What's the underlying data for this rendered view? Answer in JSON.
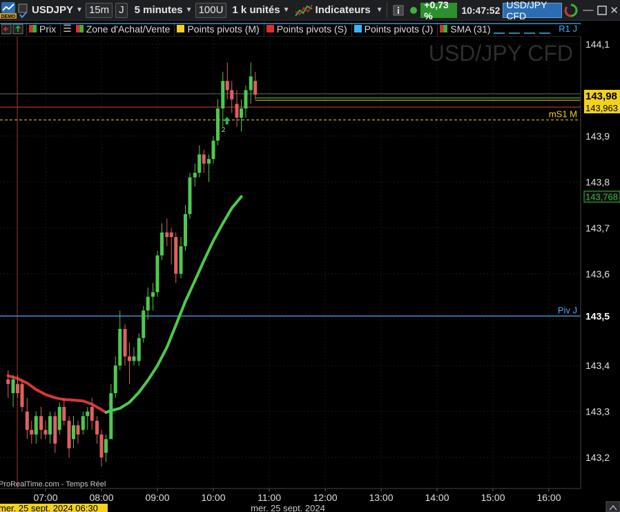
{
  "toolbar": {
    "demo_badge": "DEMO",
    "symbol": "USDJPY",
    "period": "15m",
    "period2": "J",
    "timeframe": "5 minutes",
    "units_count": "100U",
    "units_mode": "1 k unités",
    "indicators_label": "Indicateurs",
    "change_pct": "+0,73 %",
    "clock": "10:47:52",
    "instrument": "USD/JPY CFD"
  },
  "legend": [
    {
      "label": "Prix",
      "color": "#cc3333"
    },
    {
      "label": "Zone d'Achat/Vente",
      "color": "#3bb33b"
    },
    {
      "label": "Points pivots (M)",
      "color": "#f3d21b"
    },
    {
      "label": "Points pivots (S)",
      "color": "#d9312c"
    },
    {
      "label": "Points pivots (J)",
      "color": "#3fb1f5"
    },
    {
      "label": "SMA (31)",
      "color": "#3bb33b"
    }
  ],
  "watermark": "USD/JPY CFD",
  "copyright": "ProRealTime.com - Temps Réel",
  "cursor_date": "mer. 25 sept. 2024 06:30",
  "date_label": "mer. 25 sept. 2024",
  "chart_data": {
    "type": "candlestick",
    "title": "USD/JPY CFD",
    "ylim": [
      143.14,
      144.12
    ],
    "y_ticks": [
      "144,1",
      "143,9",
      "143,8",
      "143,7",
      "143,6",
      "143,5",
      "143,4",
      "143,3",
      "143,2"
    ],
    "y_tick_values": [
      144.1,
      143.9,
      143.8,
      143.7,
      143.6,
      143.5,
      143.4,
      143.3,
      143.2
    ],
    "x_ticks": [
      "07:00",
      "08:00",
      "09:00",
      "10:00",
      "11:00",
      "12:00",
      "13:00",
      "14:00",
      "15:00",
      "16:00"
    ],
    "x_tick_hours": [
      7,
      8,
      9,
      10,
      11,
      12,
      13,
      14,
      15,
      16
    ],
    "xlim_hours": [
      6.33,
      16.58
    ],
    "price_labels": [
      {
        "text": "143,98",
        "value": 143.98,
        "bg": "#f3d21b",
        "fg": "#000"
      },
      {
        "text": "143,963",
        "value": 143.963,
        "bg": "#f3d21b",
        "fg": "#000"
      },
      {
        "text": "143,768",
        "value": 143.768,
        "bg": "#111",
        "fg": "#3bb33b"
      },
      {
        "text": "143,5",
        "value": 143.508,
        "bg": "#000",
        "fg": "#fff"
      }
    ],
    "levels": [
      {
        "name": "R1 J",
        "value": 144.145,
        "color": "#3fb1f5",
        "style": "solid"
      },
      {
        "name": "",
        "value": 143.992,
        "color": "#555",
        "style": "solid"
      },
      {
        "name": "",
        "value": 143.963,
        "color": "#a33",
        "style": "solid"
      },
      {
        "name": "mS1 M",
        "value": 143.935,
        "color": "#f3d21b",
        "style": "dashed"
      },
      {
        "name": "Piv J",
        "value": 143.508,
        "color": "#3fb1f5",
        "style": "solid"
      }
    ],
    "current_price_lines": [
      143.983,
      143.978
    ],
    "candles": [
      {
        "t": 6.33,
        "o": 143.37,
        "h": 143.39,
        "l": 143.33,
        "c": 143.36
      },
      {
        "t": 6.42,
        "o": 143.34,
        "h": 143.38,
        "l": 143.31,
        "c": 143.37
      },
      {
        "t": 6.5,
        "o": 143.36,
        "h": 143.38,
        "l": 143.33,
        "c": 143.34
      },
      {
        "t": 6.58,
        "o": 143.36,
        "h": 143.37,
        "l": 143.3,
        "c": 143.31
      },
      {
        "t": 6.67,
        "o": 143.3,
        "h": 143.33,
        "l": 143.24,
        "c": 143.26
      },
      {
        "t": 6.75,
        "o": 143.26,
        "h": 143.28,
        "l": 143.23,
        "c": 143.25
      },
      {
        "t": 6.83,
        "o": 143.25,
        "h": 143.3,
        "l": 143.23,
        "c": 143.29
      },
      {
        "t": 6.92,
        "o": 143.29,
        "h": 143.31,
        "l": 143.24,
        "c": 143.26
      },
      {
        "t": 7.0,
        "o": 143.26,
        "h": 143.28,
        "l": 143.24,
        "c": 143.25
      },
      {
        "t": 7.08,
        "o": 143.25,
        "h": 143.3,
        "l": 143.23,
        "c": 143.29
      },
      {
        "t": 7.17,
        "o": 143.29,
        "h": 143.3,
        "l": 143.21,
        "c": 143.23
      },
      {
        "t": 7.25,
        "o": 143.26,
        "h": 143.32,
        "l": 143.25,
        "c": 143.31
      },
      {
        "t": 7.33,
        "o": 143.31,
        "h": 143.33,
        "l": 143.27,
        "c": 143.28
      },
      {
        "t": 7.42,
        "o": 143.28,
        "h": 143.29,
        "l": 143.2,
        "c": 143.22
      },
      {
        "t": 7.5,
        "o": 143.24,
        "h": 143.29,
        "l": 143.22,
        "c": 143.27
      },
      {
        "t": 7.58,
        "o": 143.27,
        "h": 143.28,
        "l": 143.23,
        "c": 143.25
      },
      {
        "t": 7.67,
        "o": 143.26,
        "h": 143.3,
        "l": 143.25,
        "c": 143.29
      },
      {
        "t": 7.75,
        "o": 143.29,
        "h": 143.31,
        "l": 143.26,
        "c": 143.3
      },
      {
        "t": 7.83,
        "o": 143.31,
        "h": 143.33,
        "l": 143.26,
        "c": 143.28
      },
      {
        "t": 7.92,
        "o": 143.28,
        "h": 143.29,
        "l": 143.23,
        "c": 143.25
      },
      {
        "t": 8.0,
        "o": 143.25,
        "h": 143.26,
        "l": 143.18,
        "c": 143.2
      },
      {
        "t": 8.08,
        "o": 143.21,
        "h": 143.25,
        "l": 143.19,
        "c": 143.24
      },
      {
        "t": 8.17,
        "o": 143.24,
        "h": 143.36,
        "l": 143.24,
        "c": 143.34
      },
      {
        "t": 8.25,
        "o": 143.34,
        "h": 143.42,
        "l": 143.33,
        "c": 143.4
      },
      {
        "t": 8.33,
        "o": 143.4,
        "h": 143.52,
        "l": 143.39,
        "c": 143.48
      },
      {
        "t": 8.42,
        "o": 143.48,
        "h": 143.49,
        "l": 143.4,
        "c": 143.42
      },
      {
        "t": 8.5,
        "o": 143.42,
        "h": 143.45,
        "l": 143.36,
        "c": 143.41
      },
      {
        "t": 8.58,
        "o": 143.41,
        "h": 143.44,
        "l": 143.4,
        "c": 143.42
      },
      {
        "t": 8.67,
        "o": 143.41,
        "h": 143.47,
        "l": 143.4,
        "c": 143.46
      },
      {
        "t": 8.75,
        "o": 143.46,
        "h": 143.53,
        "l": 143.45,
        "c": 143.52
      },
      {
        "t": 8.83,
        "o": 143.52,
        "h": 143.57,
        "l": 143.5,
        "c": 143.55
      },
      {
        "t": 8.92,
        "o": 143.55,
        "h": 143.58,
        "l": 143.52,
        "c": 143.56
      },
      {
        "t": 9.0,
        "o": 143.56,
        "h": 143.65,
        "l": 143.55,
        "c": 143.64
      },
      {
        "t": 9.08,
        "o": 143.64,
        "h": 143.71,
        "l": 143.63,
        "c": 143.69
      },
      {
        "t": 9.17,
        "o": 143.69,
        "h": 143.72,
        "l": 143.66,
        "c": 143.68
      },
      {
        "t": 9.25,
        "o": 143.69,
        "h": 143.7,
        "l": 143.62,
        "c": 143.68
      },
      {
        "t": 9.33,
        "o": 143.68,
        "h": 143.69,
        "l": 143.58,
        "c": 143.6
      },
      {
        "t": 9.42,
        "o": 143.6,
        "h": 143.68,
        "l": 143.59,
        "c": 143.66
      },
      {
        "t": 9.5,
        "o": 143.66,
        "h": 143.75,
        "l": 143.65,
        "c": 143.73
      },
      {
        "t": 9.58,
        "o": 143.73,
        "h": 143.82,
        "l": 143.72,
        "c": 143.81
      },
      {
        "t": 9.67,
        "o": 143.81,
        "h": 143.84,
        "l": 143.79,
        "c": 143.82
      },
      {
        "t": 9.75,
        "o": 143.82,
        "h": 143.88,
        "l": 143.81,
        "c": 143.86
      },
      {
        "t": 9.83,
        "o": 143.86,
        "h": 143.87,
        "l": 143.82,
        "c": 143.84
      },
      {
        "t": 9.92,
        "o": 143.84,
        "h": 143.86,
        "l": 143.8,
        "c": 143.85
      },
      {
        "t": 10.0,
        "o": 143.85,
        "h": 143.9,
        "l": 143.84,
        "c": 143.89
      },
      {
        "t": 10.08,
        "o": 143.89,
        "h": 143.98,
        "l": 143.88,
        "c": 143.96
      },
      {
        "t": 10.17,
        "o": 143.96,
        "h": 144.04,
        "l": 143.92,
        "c": 144.02
      },
      {
        "t": 10.25,
        "o": 144.02,
        "h": 144.06,
        "l": 143.98,
        "c": 144.0
      },
      {
        "t": 10.33,
        "o": 144.0,
        "h": 144.02,
        "l": 143.95,
        "c": 143.98
      },
      {
        "t": 10.42,
        "o": 143.97,
        "h": 144.0,
        "l": 143.92,
        "c": 143.94
      },
      {
        "t": 10.5,
        "o": 143.94,
        "h": 143.98,
        "l": 143.91,
        "c": 143.96
      },
      {
        "t": 10.58,
        "o": 143.96,
        "h": 144.01,
        "l": 143.94,
        "c": 144.0
      },
      {
        "t": 10.67,
        "o": 144.0,
        "h": 144.06,
        "l": 143.97,
        "c": 144.03
      },
      {
        "t": 10.75,
        "o": 144.02,
        "h": 144.04,
        "l": 143.98,
        "c": 143.99
      }
    ],
    "sma": [
      {
        "t": 6.33,
        "v": 143.378
      },
      {
        "t": 6.5,
        "v": 143.372
      },
      {
        "t": 6.67,
        "v": 143.362
      },
      {
        "t": 6.83,
        "v": 143.348
      },
      {
        "t": 7.0,
        "v": 143.337
      },
      {
        "t": 7.17,
        "v": 143.33
      },
      {
        "t": 7.33,
        "v": 143.326
      },
      {
        "t": 7.5,
        "v": 143.325
      },
      {
        "t": 7.67,
        "v": 143.323
      },
      {
        "t": 7.83,
        "v": 143.316
      },
      {
        "t": 8.0,
        "v": 143.304
      },
      {
        "t": 8.08,
        "v": 143.298
      },
      {
        "t": 8.17,
        "v": 143.302
      },
      {
        "t": 8.33,
        "v": 143.307
      },
      {
        "t": 8.5,
        "v": 143.32
      },
      {
        "t": 8.67,
        "v": 143.342
      },
      {
        "t": 8.83,
        "v": 143.368
      },
      {
        "t": 9.0,
        "v": 143.4
      },
      {
        "t": 9.17,
        "v": 143.44
      },
      {
        "t": 9.33,
        "v": 143.488
      },
      {
        "t": 9.5,
        "v": 143.54
      },
      {
        "t": 9.67,
        "v": 143.585
      },
      {
        "t": 9.83,
        "v": 143.628
      },
      {
        "t": 10.0,
        "v": 143.672
      },
      {
        "t": 10.17,
        "v": 143.71
      },
      {
        "t": 10.33,
        "v": 143.743
      },
      {
        "t": 10.5,
        "v": 143.768
      }
    ],
    "sma_split_hour": 8.08,
    "marker": {
      "t": 10.17,
      "v": 143.93,
      "label": "2"
    }
  }
}
